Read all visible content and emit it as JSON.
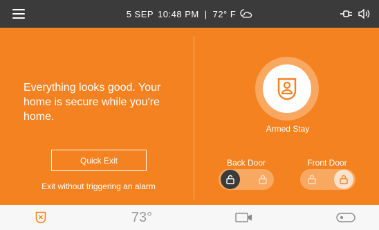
{
  "status_bar": {
    "date": "5 SEP",
    "time": "10:48 PM",
    "separator": "|",
    "temperature": "72° F",
    "icons": [
      "menu-icon",
      "partly-cloudy-night-icon",
      "plug-icon",
      "speaker-icon"
    ]
  },
  "main": {
    "background_color": "#f58220",
    "message": "Everything looks good. Your home is secure while you're home.",
    "quick_exit_label": "Quick Exit",
    "exit_caption": "Exit without triggering an alarm",
    "arm_state": "Armed Stay",
    "arm_icon": "shield-person-icon",
    "doors": [
      {
        "label": "Back Door",
        "state": "unlocked"
      },
      {
        "label": "Front Door",
        "state": "locked"
      }
    ]
  },
  "bottom_nav": {
    "thermostat_temp": "73°",
    "icons": [
      "security-shield-icon",
      "camera-icon",
      "toggle-switch-icon"
    ]
  }
}
